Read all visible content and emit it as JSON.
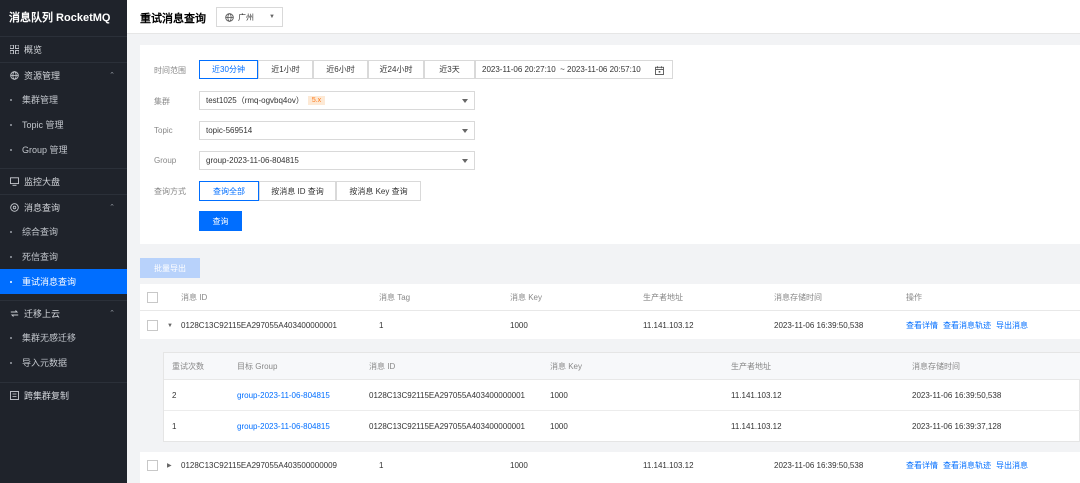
{
  "sidebar": {
    "brand": "消息队列 RocketMQ",
    "items": [
      {
        "label": "概览",
        "icon": "grid-icon"
      },
      {
        "label": "资源管理",
        "icon": "globe-icon"
      },
      {
        "label": "集群管理"
      },
      {
        "label": "Topic 管理"
      },
      {
        "label": "Group 管理"
      },
      {
        "label": "监控大盘",
        "icon": "monitor-icon"
      },
      {
        "label": "消息查询",
        "icon": "search-icon"
      },
      {
        "label": "综合查询"
      },
      {
        "label": "死信查询"
      },
      {
        "label": "重试消息查询"
      },
      {
        "label": "迁移上云",
        "icon": "migrate-icon"
      },
      {
        "label": "集群无感迁移"
      },
      {
        "label": "导入元数据"
      },
      {
        "label": "跨集群复制",
        "icon": "copy-icon"
      }
    ]
  },
  "header": {
    "title": "重试消息查询",
    "region": "广州"
  },
  "filters": {
    "time_label": "时间范围",
    "time_options": [
      "近30分钟",
      "近1小时",
      "近6小时",
      "近24小时",
      "近3天"
    ],
    "time_selected": "近30分钟",
    "date_range": "2023-11-06 20:27:10  ~ 2023-11-06 20:57:10",
    "cluster_label": "集群",
    "cluster_value": "test1025（rmq-ogvbq4ov）",
    "cluster_version": "5.x",
    "topic_label": "Topic",
    "topic_value": "topic-569514",
    "group_label": "Group",
    "group_value": "group-2023-11-06-804815",
    "method_label": "查询方式",
    "method_options": [
      "查询全部",
      "按消息 ID 查询",
      "按消息 Key 查询"
    ],
    "method_selected": "查询全部",
    "query_button": "查询"
  },
  "batch_export": "批量导出",
  "table": {
    "columns": [
      "消息 ID",
      "消息 Tag",
      "消息 Key",
      "生产者地址",
      "消息存储时间",
      "操作"
    ],
    "actions": [
      "查看详情",
      "查看消息轨迹",
      "导出消息"
    ],
    "rows": [
      {
        "id": "0128C13C92115EA297055A403400000001",
        "tag": "1",
        "key": "1000",
        "producer": "11.141.103.12",
        "time": "2023-11-06 16:39:50,538"
      },
      {
        "id": "0128C13C92115EA297055A403500000009",
        "tag": "1",
        "key": "1000",
        "producer": "11.141.103.12",
        "time": "2023-11-06 16:39:50,538"
      }
    ]
  },
  "subtable": {
    "columns": [
      "重试次数",
      "目标 Group",
      "消息 ID",
      "消息 Key",
      "生产者地址",
      "消息存储时间"
    ],
    "rows": [
      {
        "retry": "2",
        "group": "group-2023-11-06-804815",
        "id": "0128C13C92115EA297055A403400000001",
        "key": "1000",
        "producer": "11.141.103.12",
        "time": "2023-11-06 16:39:50,538"
      },
      {
        "retry": "1",
        "group": "group-2023-11-06-804815",
        "id": "0128C13C92115EA297055A403400000001",
        "key": "1000",
        "producer": "11.141.103.12",
        "time": "2023-11-06 16:39:37,128"
      }
    ]
  },
  "colors": {
    "accent": "#006eff",
    "sidebar_bg": "#1f232b",
    "tag_bg": "#fde9d5",
    "tag_text": "#ff7a1a"
  }
}
